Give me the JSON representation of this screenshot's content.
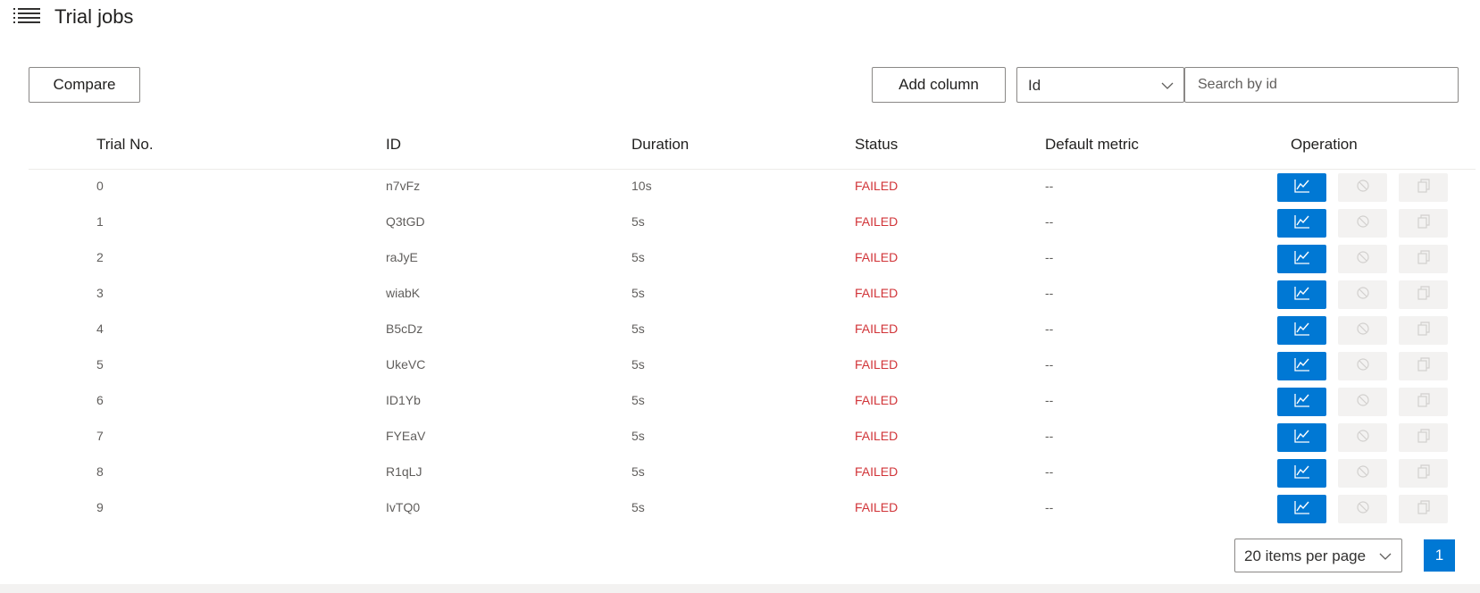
{
  "header": {
    "title": "Trial jobs",
    "menu_icon": "hamburger-list-icon"
  },
  "toolbar": {
    "compare_label": "Compare",
    "add_column_label": "Add column",
    "filter_select_value": "Id",
    "search_placeholder": "Search by id"
  },
  "table": {
    "columns": [
      "Trial No.",
      "ID",
      "Duration",
      "Status",
      "Default metric",
      "Operation"
    ],
    "rows": [
      {
        "trial_no": "0",
        "id": "n7vFz",
        "duration": "10s",
        "status": "FAILED",
        "metric": "--"
      },
      {
        "trial_no": "1",
        "id": "Q3tGD",
        "duration": "5s",
        "status": "FAILED",
        "metric": "--"
      },
      {
        "trial_no": "2",
        "id": "raJyE",
        "duration": "5s",
        "status": "FAILED",
        "metric": "--"
      },
      {
        "trial_no": "3",
        "id": "wiabK",
        "duration": "5s",
        "status": "FAILED",
        "metric": "--"
      },
      {
        "trial_no": "4",
        "id": "B5cDz",
        "duration": "5s",
        "status": "FAILED",
        "metric": "--"
      },
      {
        "trial_no": "5",
        "id": "UkeVC",
        "duration": "5s",
        "status": "FAILED",
        "metric": "--"
      },
      {
        "trial_no": "6",
        "id": "ID1Yb",
        "duration": "5s",
        "status": "FAILED",
        "metric": "--"
      },
      {
        "trial_no": "7",
        "id": "FYEaV",
        "duration": "5s",
        "status": "FAILED",
        "metric": "--"
      },
      {
        "trial_no": "8",
        "id": "R1qLJ",
        "duration": "5s",
        "status": "FAILED",
        "metric": "--"
      },
      {
        "trial_no": "9",
        "id": "IvTQ0",
        "duration": "5s",
        "status": "FAILED",
        "metric": "--"
      }
    ],
    "operation_icons": [
      "chart-icon",
      "cancel-icon",
      "copy-icon"
    ]
  },
  "pagination": {
    "items_per_page_label": "20 items per page",
    "current_page": "1"
  },
  "colors": {
    "accent": "#0078d4",
    "failed": "#d13438",
    "disabled_bg": "#f3f2f1"
  }
}
